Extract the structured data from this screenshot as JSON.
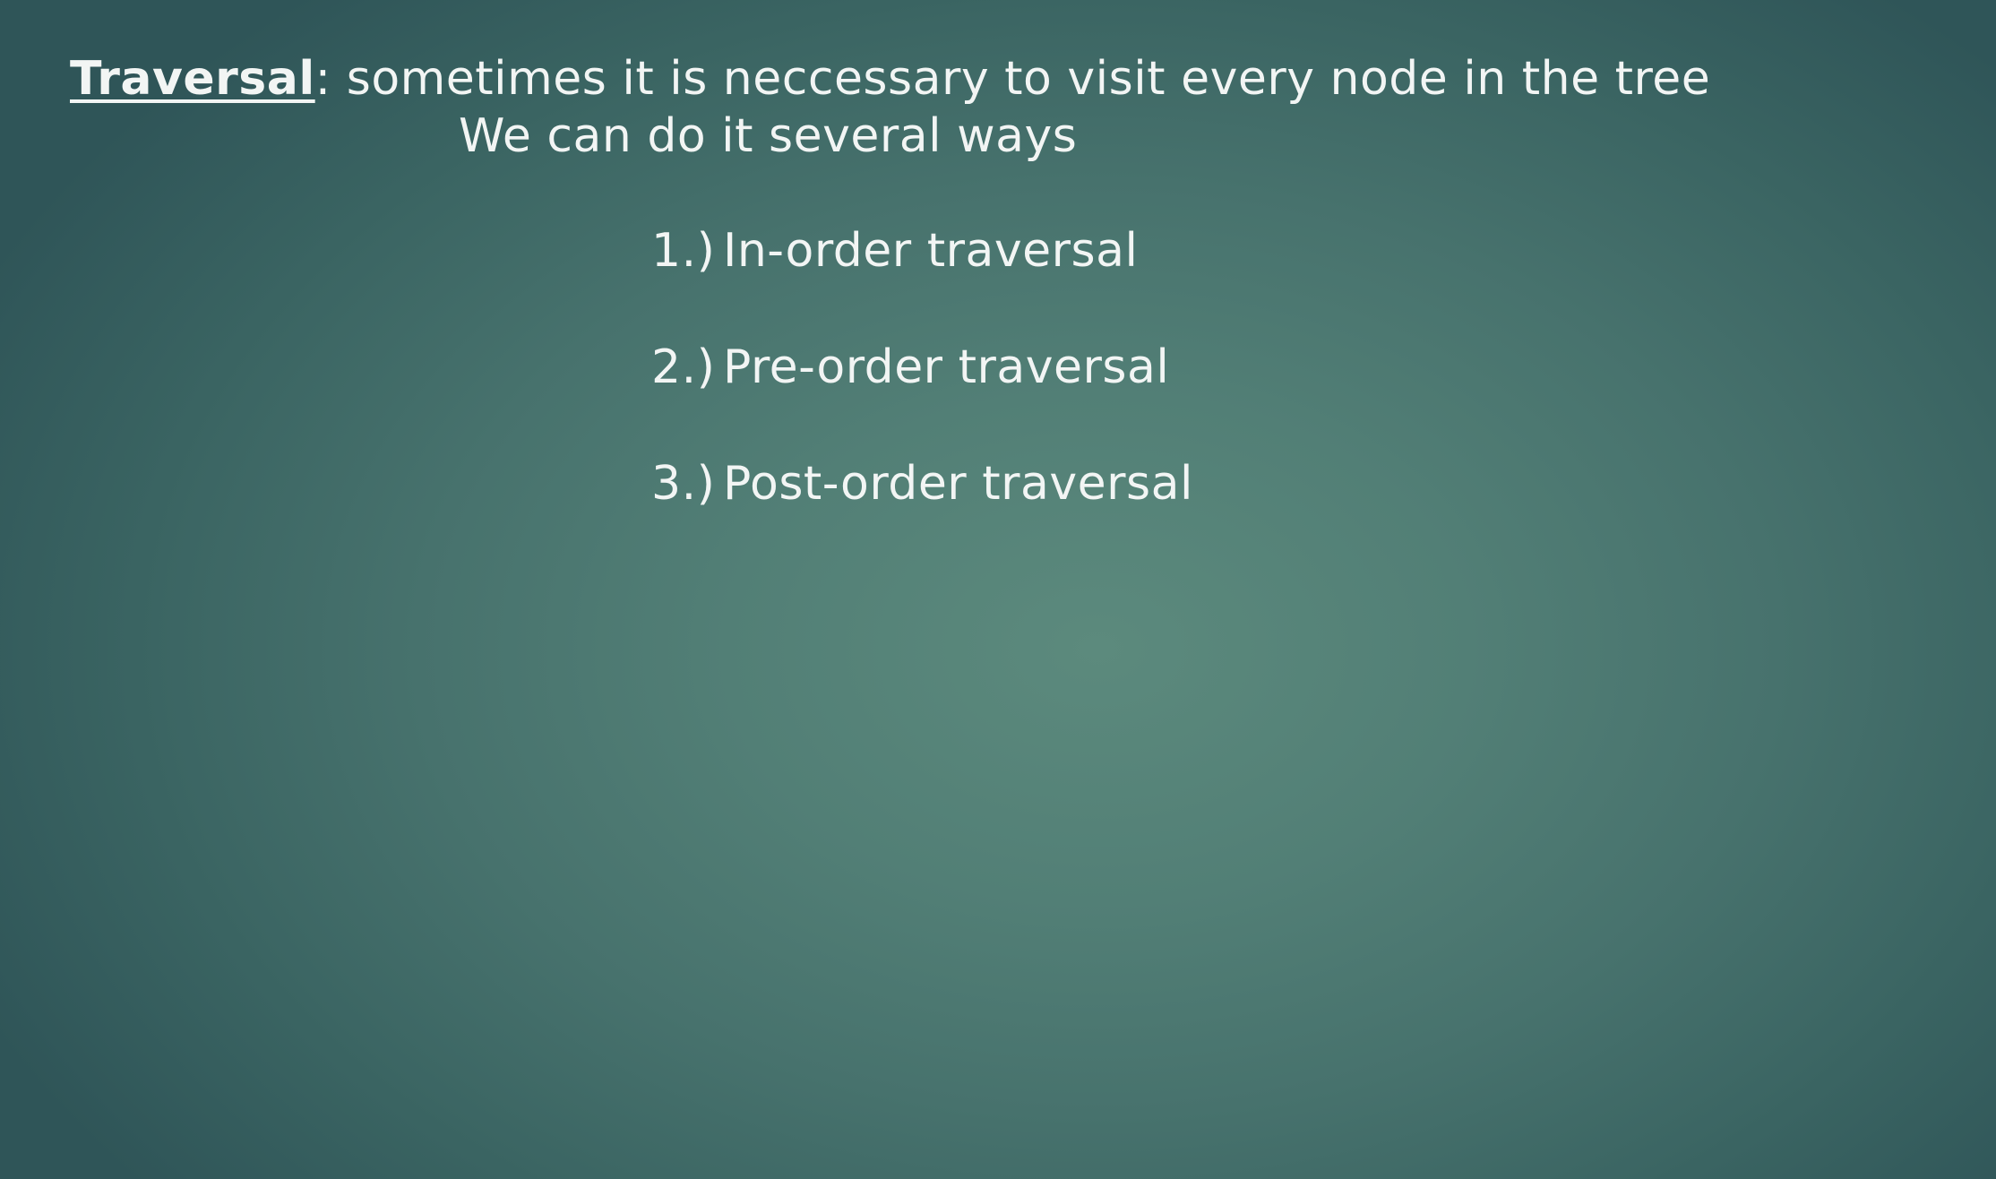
{
  "slide": {
    "term": "Traversal",
    "definition": ": sometimes it is neccessary to visit every node in the tree",
    "subline": "We can do it several ways",
    "items": [
      {
        "number": "1.)",
        "text": "In-order traversal"
      },
      {
        "number": "2.)",
        "text": "Pre-order traversal"
      },
      {
        "number": "3.)",
        "text": "Post-order traversal"
      }
    ]
  }
}
